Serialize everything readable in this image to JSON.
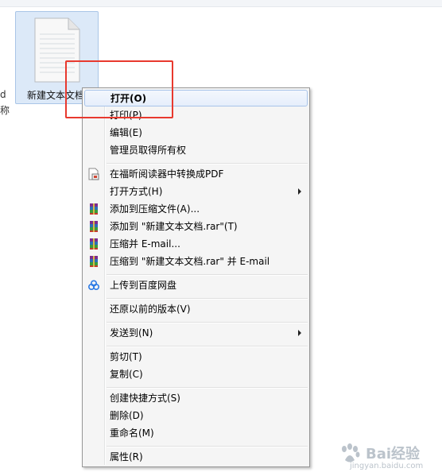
{
  "desktop": {
    "left_fragment_line1": "d",
    "left_fragment_line2": "称",
    "file": {
      "label": "新建文本文档",
      "icon": "text-document-icon"
    }
  },
  "context_menu": {
    "items": [
      {
        "label": "打开(O)",
        "bold": true,
        "icon": null
      },
      {
        "label": "打印(P)",
        "icon": null
      },
      {
        "label": "编辑(E)",
        "icon": null
      },
      {
        "label": "管理员取得所有权",
        "icon": null
      },
      {
        "label": "在福昕阅读器中转换成PDF",
        "icon": "foxit-pdf-icon"
      },
      {
        "label": "打开方式(H)",
        "icon": null,
        "submenu": true
      },
      {
        "label": "添加到压缩文件(A)...",
        "icon": "winrar-icon"
      },
      {
        "label": "添加到 \"新建文本文档.rar\"(T)",
        "icon": "winrar-icon"
      },
      {
        "label": "压缩并 E-mail...",
        "icon": "winrar-icon"
      },
      {
        "label": "压缩到 \"新建文本文档.rar\" 并 E-mail",
        "icon": "winrar-icon"
      },
      {
        "label": "上传到百度网盘",
        "icon": "baidu-netdisk-icon"
      },
      {
        "label": "还原以前的版本(V)",
        "icon": null
      },
      {
        "label": "发送到(N)",
        "icon": null,
        "submenu": true
      },
      {
        "label": "剪切(T)",
        "icon": null
      },
      {
        "label": "复制(C)",
        "icon": null
      },
      {
        "label": "创建快捷方式(S)",
        "icon": null
      },
      {
        "label": "删除(D)",
        "icon": null
      },
      {
        "label": "重命名(M)",
        "icon": null
      },
      {
        "label": "属性(R)",
        "icon": null
      }
    ]
  },
  "annotation": {
    "color": "#e8392e"
  },
  "watermark": {
    "brand": "Bai经验",
    "url": "jingyan.baidu.com"
  }
}
